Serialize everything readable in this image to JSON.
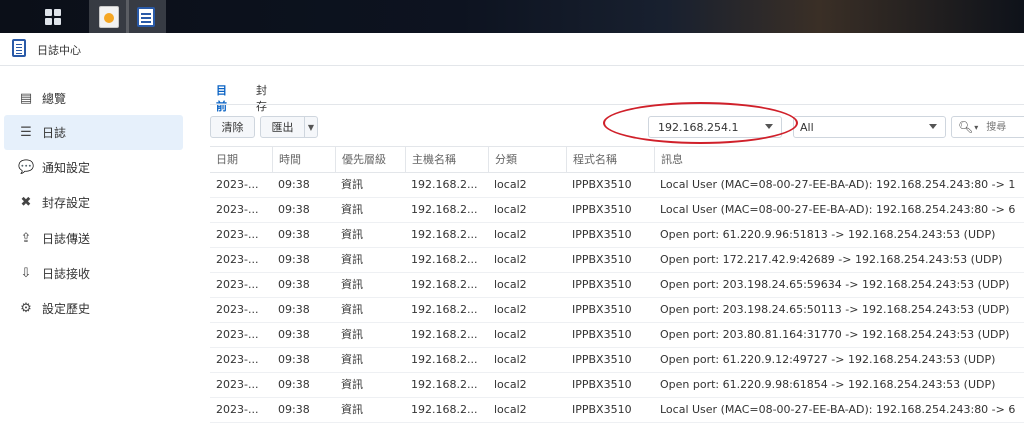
{
  "taskbar": {
    "icons": [
      "apps-grid-icon",
      "app-icon",
      "log-center-icon"
    ]
  },
  "window": {
    "title": "日誌中心"
  },
  "sidebar": {
    "items": [
      {
        "label": "總覽",
        "icon": "overview-icon",
        "glyph": "▤"
      },
      {
        "label": "日誌",
        "icon": "list-icon",
        "glyph": "☰"
      },
      {
        "label": "通知設定",
        "icon": "chat-icon",
        "glyph": "💬"
      },
      {
        "label": "封存設定",
        "icon": "tools-icon",
        "glyph": "✖"
      },
      {
        "label": "日誌傳送",
        "icon": "upload-icon",
        "glyph": "⇪"
      },
      {
        "label": "日誌接收",
        "icon": "download-icon",
        "glyph": "⇩"
      },
      {
        "label": "設定歷史",
        "icon": "gear-icon",
        "glyph": "⚙"
      }
    ],
    "active_index": 1
  },
  "tabs": [
    {
      "label": "目前"
    },
    {
      "label": "封存"
    }
  ],
  "toolbar": {
    "clear_label": "清除",
    "export_label": "匯出",
    "host_filter": "192.168.254.1",
    "level_filter": "All",
    "search_placeholder": "搜尋"
  },
  "table": {
    "columns": [
      "日期",
      "時間",
      "優先層級",
      "主機名稱",
      "分類",
      "程式名稱",
      "訊息"
    ],
    "rows": [
      [
        "2023-...",
        "09:38",
        "資訊",
        "192.168.2...",
        "local2",
        "IPPBX3510",
        "Local User (MAC=08-00-27-EE-BA-AD): 192.168.254.243:80 -> 1"
      ],
      [
        "2023-...",
        "09:38",
        "資訊",
        "192.168.2...",
        "local2",
        "IPPBX3510",
        "Local User (MAC=08-00-27-EE-BA-AD): 192.168.254.243:80 -> 6"
      ],
      [
        "2023-...",
        "09:38",
        "資訊",
        "192.168.2...",
        "local2",
        "IPPBX3510",
        "Open port: 61.220.9.96:51813 -> 192.168.254.243:53 (UDP)"
      ],
      [
        "2023-...",
        "09:38",
        "資訊",
        "192.168.2...",
        "local2",
        "IPPBX3510",
        "Open port: 172.217.42.9:42689 -> 192.168.254.243:53 (UDP)"
      ],
      [
        "2023-...",
        "09:38",
        "資訊",
        "192.168.2...",
        "local2",
        "IPPBX3510",
        "Open port: 203.198.24.65:59634 -> 192.168.254.243:53 (UDP)"
      ],
      [
        "2023-...",
        "09:38",
        "資訊",
        "192.168.2...",
        "local2",
        "IPPBX3510",
        "Open port: 203.198.24.65:50113 -> 192.168.254.243:53 (UDP)"
      ],
      [
        "2023-...",
        "09:38",
        "資訊",
        "192.168.2...",
        "local2",
        "IPPBX3510",
        "Open port: 203.80.81.164:31770 -> 192.168.254.243:53 (UDP)"
      ],
      [
        "2023-...",
        "09:38",
        "資訊",
        "192.168.2...",
        "local2",
        "IPPBX3510",
        "Open port: 61.220.9.12:49727 -> 192.168.254.243:53 (UDP)"
      ],
      [
        "2023-...",
        "09:38",
        "資訊",
        "192.168.2...",
        "local2",
        "IPPBX3510",
        "Open port: 61.220.9.98:61854 -> 192.168.254.243:53 (UDP)"
      ],
      [
        "2023-...",
        "09:38",
        "資訊",
        "192.168.2...",
        "local2",
        "IPPBX3510",
        "Local User (MAC=08-00-27-EE-BA-AD): 192.168.254.243:80 -> 6"
      ]
    ]
  },
  "colors": {
    "accent": "#0b63c4",
    "active_nav_bg": "#e6f0fb",
    "annotation": "#d0202a"
  }
}
